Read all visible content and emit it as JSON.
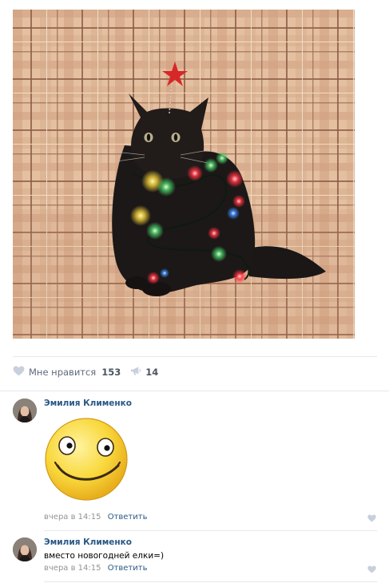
{
  "post": {
    "likes": {
      "label": "Мне нравится",
      "count": "153"
    },
    "shares": {
      "count": "14"
    }
  },
  "comments": [
    {
      "author": "Эмилия Клименко",
      "text": "",
      "sticker": "smiley-face",
      "date": "вчера в 14:15",
      "reply_label": "Ответить"
    },
    {
      "author": "Эмилия Клименко",
      "text": "вместо новогодней елки=)",
      "date": "вчера в 14:15",
      "reply_label": "Ответить"
    }
  ],
  "icons": {
    "like": "heart-icon",
    "share": "megaphone-icon",
    "comment_like": "heart-icon"
  },
  "colors": {
    "link": "#2a5885",
    "muted": "#939393",
    "separator": "#e7e8ec",
    "sticker_face": "#f9d83c"
  }
}
